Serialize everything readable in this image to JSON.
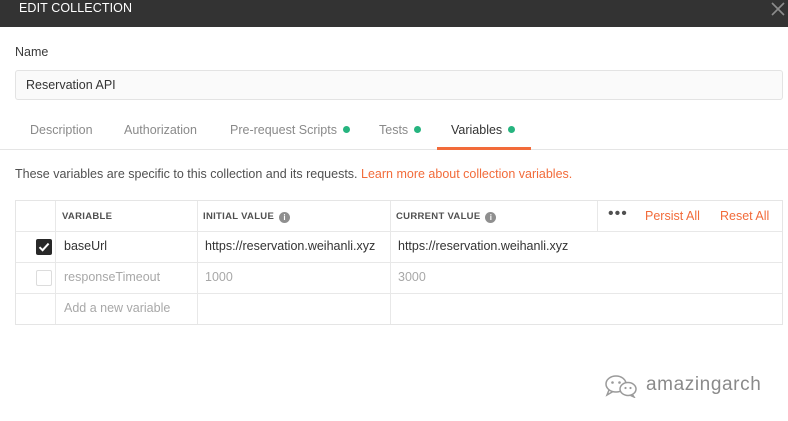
{
  "window": {
    "title": "EDIT COLLECTION",
    "close_icon": "close-icon"
  },
  "name_field": {
    "label": "Name",
    "value": "Reservation API"
  },
  "tabs": [
    {
      "label": "Description",
      "has_dot": false,
      "active": false
    },
    {
      "label": "Authorization",
      "has_dot": false,
      "active": false
    },
    {
      "label": "Pre-request Scripts",
      "has_dot": true,
      "active": false
    },
    {
      "label": "Tests",
      "has_dot": true,
      "active": false
    },
    {
      "label": "Variables",
      "has_dot": true,
      "active": true
    }
  ],
  "info": {
    "text": "These variables are specific to this collection and its requests.",
    "link": "Learn more about collection variables."
  },
  "table": {
    "headers": {
      "variable": "VARIABLE",
      "initial_value": "INITIAL VALUE",
      "current_value": "CURRENT VALUE",
      "info_icon_glyph": "i"
    },
    "more_glyph": "•••",
    "persist_all": "Persist All",
    "reset_all": "Reset All",
    "rows": [
      {
        "enabled": true,
        "variable": "baseUrl",
        "initial_value": "https://reservation.weihanli.xyz",
        "current_value": "https://reservation.weihanli.xyz"
      },
      {
        "enabled": false,
        "variable": "responseTimeout",
        "initial_value": "1000",
        "current_value": "3000"
      }
    ],
    "new_variable_placeholder": "Add a new variable"
  },
  "watermark": {
    "text": "amazingarch",
    "icon": "wechat-icon"
  },
  "colors": {
    "accent": "#f26b3a",
    "status_dot": "#26b47f",
    "titlebar": "#333333"
  }
}
